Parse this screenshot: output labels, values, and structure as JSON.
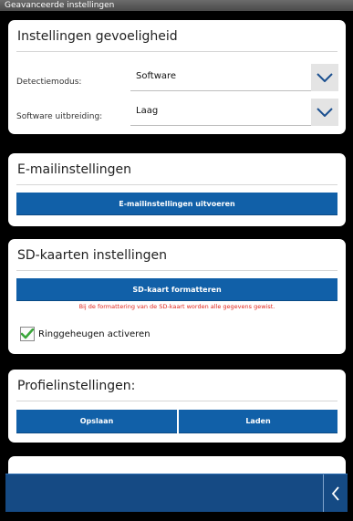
{
  "window": {
    "title": "Geavanceerde instellingen"
  },
  "sensitivity": {
    "title": "Instellingen gevoeligheid",
    "detection_label": "Detectiemodus:",
    "detection_value": "Software",
    "extension_label": "Software uitbreiding:",
    "extension_value": "Laag"
  },
  "email": {
    "title": "E-mailinstellingen",
    "button_label": "E-mailinstellingen uitvoeren"
  },
  "sd": {
    "title": "SD-kaarten instellingen",
    "format_button_label": "SD-kaart formatteren",
    "warning": "Bij de formattering van de SD-kaart worden alle gegevens gewist.",
    "ring_label": "Ringgeheugen activeren",
    "ring_checked": true
  },
  "profile": {
    "title": "Profielinstellingen:",
    "save_label": "Opslaan",
    "load_label": "Laden"
  },
  "colors": {
    "accent": "#1160a8",
    "navbar": "#154a84",
    "warning": "#e0241b",
    "check": "#3aa63a"
  }
}
